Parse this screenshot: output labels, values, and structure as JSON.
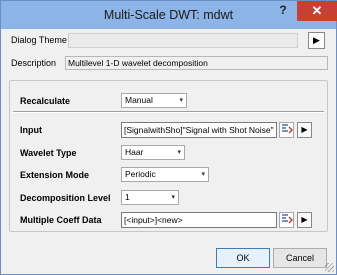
{
  "window": {
    "title": "Multi-Scale DWT: mdwt",
    "help_label": "?",
    "close_label": "✕"
  },
  "theme": {
    "label": "Dialog Theme",
    "value": "",
    "button_icon": "play-right-arrow-icon",
    "button_label": "▶"
  },
  "description": {
    "label": "Description",
    "value": "Multilevel 1-D wavelet decomposition"
  },
  "recalculate": {
    "label": "Recalculate",
    "value": "Manual"
  },
  "input": {
    "label": "Input",
    "value": "[SignalwithSho]\"Signal with Shot Noise\"",
    "picker_icon": "column-picker-icon",
    "menu_label": "▶"
  },
  "wavelet_type": {
    "label": "Wavelet Type",
    "value": "Haar"
  },
  "extension_mode": {
    "label": "Extension Mode",
    "value": "Periodic"
  },
  "decomposition_level": {
    "label": "Decomposition Level",
    "value": "1"
  },
  "multiple_coeff": {
    "label": "Multiple Coeff Data",
    "value": "[<input>]<new>",
    "picker_icon": "column-picker-icon",
    "menu_label": "▶"
  },
  "buttons": {
    "ok": "OK",
    "cancel": "Cancel"
  },
  "dropdown_glyph": "▾",
  "colors": {
    "titlebar": "#8cb4e6",
    "close_button": "#c74133",
    "dialog_bg": "#f0f0f0"
  }
}
